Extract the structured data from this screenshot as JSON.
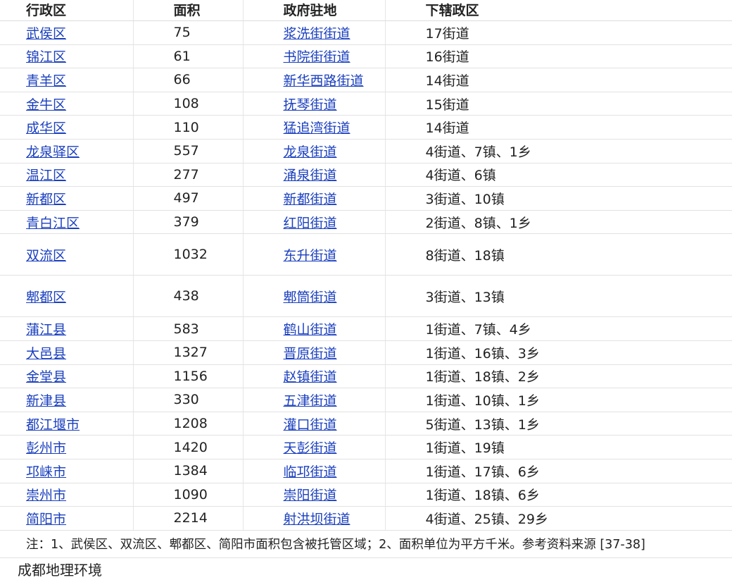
{
  "headers": [
    "行政区",
    "面积",
    "政府驻地",
    "下辖政区"
  ],
  "rows": [
    {
      "district": "武侯区",
      "area": "75",
      "seat": "浆洗街街道",
      "sub": "17街道"
    },
    {
      "district": "锦江区",
      "area": "61",
      "seat": "书院街街道",
      "sub": "16街道"
    },
    {
      "district": "青羊区",
      "area": "66",
      "seat": "新华西路街道",
      "sub": "14街道"
    },
    {
      "district": "金牛区",
      "area": "108",
      "seat": "抚琴街道",
      "sub": "15街道"
    },
    {
      "district": "成华区",
      "area": "110",
      "seat": "猛追湾街道",
      "sub": "14街道"
    },
    {
      "district": "龙泉驿区",
      "area": "557",
      "seat": "龙泉街道",
      "sub": "4街道、7镇、1乡"
    },
    {
      "district": "温江区",
      "area": "277",
      "seat": "涌泉街道",
      "sub": "4街道、6镇"
    },
    {
      "district": "新都区",
      "area": "497",
      "seat": "新都街道",
      "sub": "3街道、10镇"
    },
    {
      "district": "青白江区",
      "area": "379",
      "seat": "红阳街道",
      "sub": "2街道、8镇、1乡"
    },
    {
      "district": "双流区",
      "area": "1032",
      "seat": "东升街道",
      "sub": "8街道、18镇"
    },
    {
      "district": "郫都区",
      "area": "438",
      "seat": "郫筒街道",
      "sub": "3街道、13镇"
    },
    {
      "district": "蒲江县",
      "area": "583",
      "seat": "鹤山街道",
      "sub": "1街道、7镇、4乡"
    },
    {
      "district": "大邑县",
      "area": "1327",
      "seat": "晋原街道",
      "sub": "1街道、16镇、3乡"
    },
    {
      "district": "金堂县",
      "area": "1156",
      "seat": "赵镇街道",
      "sub": "1街道、18镇、2乡"
    },
    {
      "district": "新津县",
      "area": "330",
      "seat": "五津街道",
      "sub": "1街道、10镇、1乡"
    },
    {
      "district": "都江堰市",
      "area": "1208",
      "seat": "灌口街道",
      "sub": "5街道、13镇、1乡"
    },
    {
      "district": "彭州市",
      "area": "1420",
      "seat": "天彭街道",
      "sub": "1街道、19镇"
    },
    {
      "district": "邛崃市",
      "area": "1384",
      "seat": "临邛街道",
      "sub": "1街道、17镇、6乡"
    },
    {
      "district": "崇州市",
      "area": "1090",
      "seat": "崇阳街道",
      "sub": "1街道、18镇、6乡"
    },
    {
      "district": "简阳市",
      "area": "2214",
      "seat": "射洪坝街道",
      "sub": "4街道、25镇、29乡"
    }
  ],
  "note": "注：1、武侯区、双流区、郫都区、简阳市面积包含被托管区域；2、面积单位为平方千米。参考资料来源 [37-38]",
  "caption": "成都地理环境",
  "colors": {
    "link": "#1a3fbf",
    "text": "#222222",
    "border": "#e2e2e2"
  }
}
